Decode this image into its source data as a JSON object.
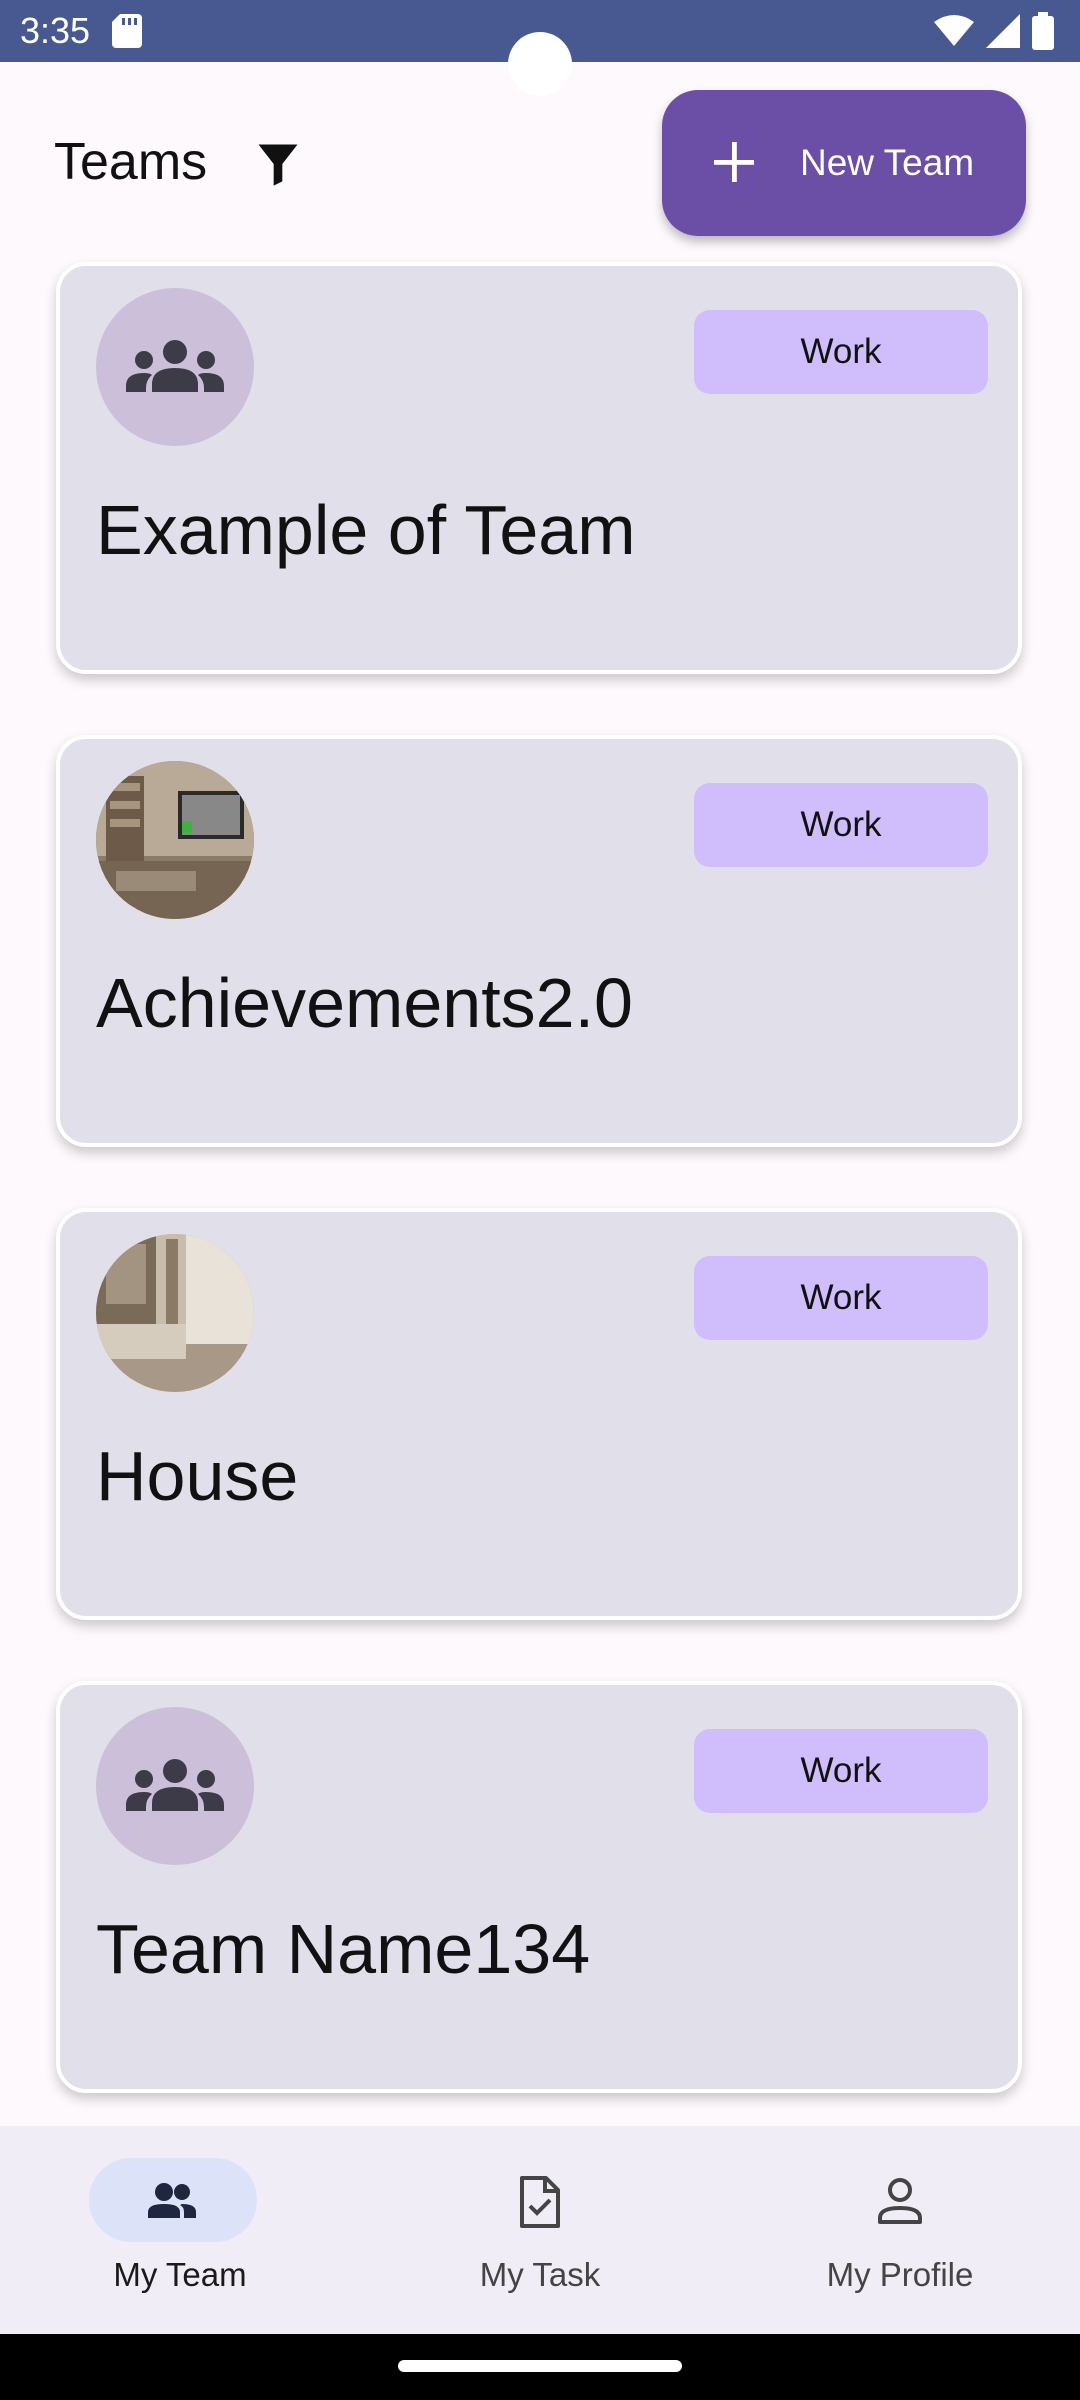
{
  "status_bar": {
    "time": "3:35"
  },
  "header": {
    "title": "Teams",
    "new_team_label": "New Team"
  },
  "teams": [
    {
      "name": "Example of Team",
      "tag": "Work",
      "avatar": "group-icon"
    },
    {
      "name": "Achievements2.0",
      "tag": "Work",
      "avatar": "photo"
    },
    {
      "name": "House",
      "tag": "Work",
      "avatar": "photo"
    },
    {
      "name": "Team Name134",
      "tag": "Work",
      "avatar": "group-icon"
    }
  ],
  "bottom_nav": {
    "items": [
      {
        "label": "My Team",
        "icon": "group-icon",
        "active": true
      },
      {
        "label": "My Task",
        "icon": "task-icon",
        "active": false
      },
      {
        "label": "My Profile",
        "icon": "person-icon",
        "active": false
      }
    ]
  },
  "colors": {
    "status_bar": "#475990",
    "primary": "#6b4fa6",
    "card": "#e1dfe9",
    "tag": "#cfbdfc",
    "nav_active_pill": "#dce2f8"
  }
}
